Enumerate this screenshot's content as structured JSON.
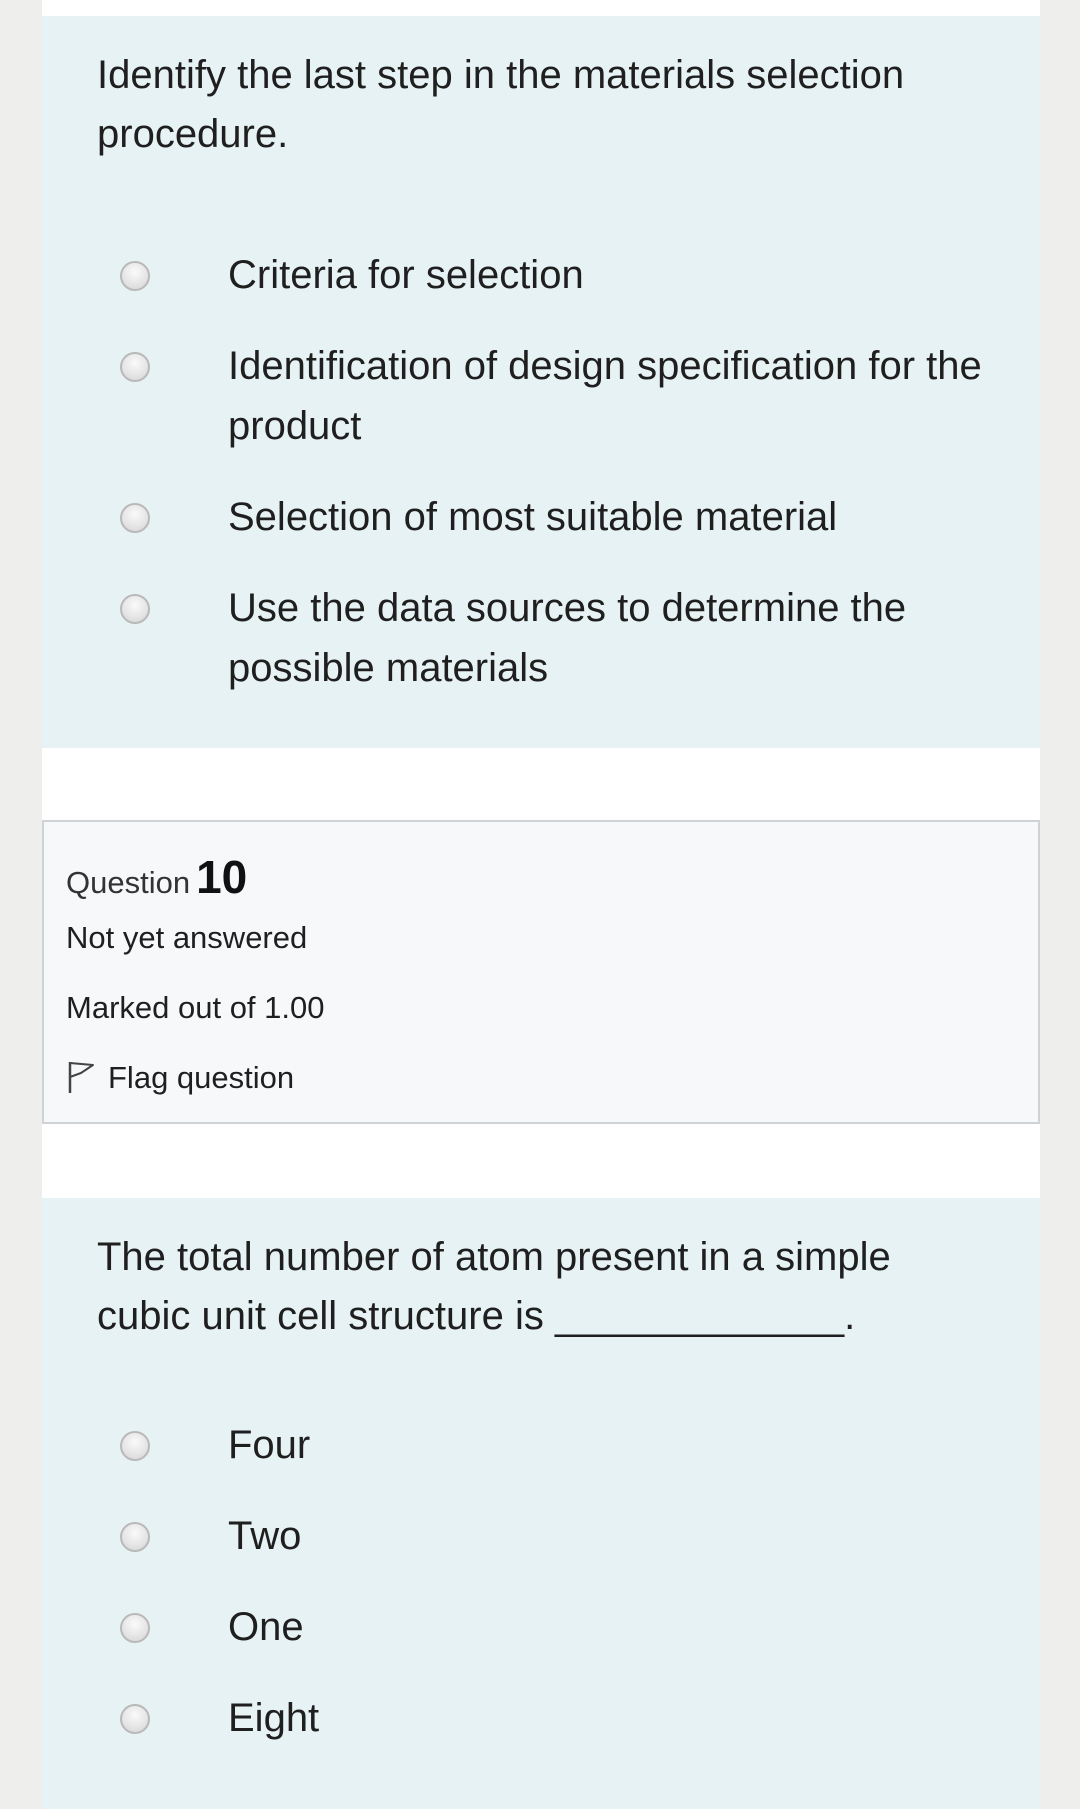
{
  "question9": {
    "text": "Identify the last step in the materials selection procedure.",
    "options": [
      "Criteria for selection",
      "Identification of design specification for the product",
      "Selection of most suitable material",
      "Use the data sources to determine the possible materials"
    ]
  },
  "question10_info": {
    "question_word": "Question",
    "question_number": "10",
    "status": "Not yet answered",
    "marked": "Marked out of 1.00",
    "flag_label": "Flag question"
  },
  "question10": {
    "text": "The total number of atom present in a simple cubic unit cell structure is _____________.",
    "options": [
      "Four",
      "Two",
      "One",
      "Eight"
    ]
  },
  "colors": {
    "card_background": "#e7f2f4",
    "info_background": "#f6f8fa",
    "page_background": "#ffffff"
  }
}
